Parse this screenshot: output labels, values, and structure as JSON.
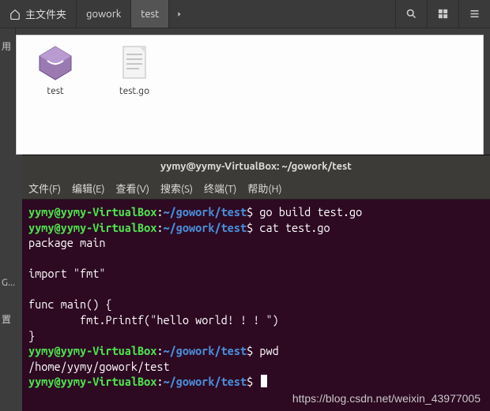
{
  "breadcrumb": {
    "home_label": "主文件夹",
    "items": [
      "gowork",
      "test"
    ],
    "active": "test"
  },
  "sidebar": {
    "partial1": "用",
    "partial2": "G...",
    "partial3": "置"
  },
  "files": [
    {
      "name": "test",
      "type": "binary"
    },
    {
      "name": "test.go",
      "type": "text"
    }
  ],
  "terminal": {
    "title": "yymy@yymy-VirtualBox: ~/gowork/test",
    "menu": {
      "file": "文件(F)",
      "edit": "编辑(E)",
      "view": "查看(V)",
      "search": "搜索(S)",
      "terminal": "终端(T)",
      "help": "帮助(H)"
    },
    "prompt": {
      "user": "yymy@yymy-VirtualBox",
      "path": "~/gowork/test",
      "symbol": "$"
    },
    "lines": {
      "cmd1": "go build test.go",
      "cmd2": "cat test.go",
      "out1": "package main",
      "out2": "import \"fmt\"",
      "out3": "func main() {",
      "out4": "        fmt.Printf(\"hello world! ! ! \")",
      "out5": "}",
      "cmd3": "pwd",
      "out6": "/home/yymy/gowork/test"
    }
  },
  "watermark": "https://blog.csdn.net/weixin_43977005"
}
